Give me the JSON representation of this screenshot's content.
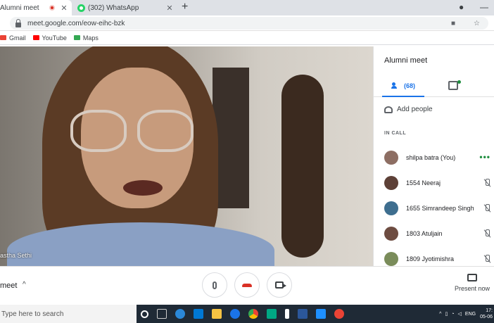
{
  "browser": {
    "tabs": [
      {
        "title": "Alumni meet",
        "recording": true
      },
      {
        "title": "(302) WhatsApp"
      }
    ],
    "url": "meet.google.com/eow-eihc-bzk",
    "bookmarks": [
      {
        "label": "Gmail",
        "icon": "gmail-icon",
        "color": "#ea4335"
      },
      {
        "label": "YouTube",
        "icon": "youtube-icon",
        "color": "#ff0000"
      },
      {
        "label": "Maps",
        "icon": "maps-icon",
        "color": "#34a853"
      }
    ]
  },
  "meeting": {
    "title": "Alumni meet",
    "participant_count": "(68)",
    "add_people": "Add people",
    "in_call_label": "IN CALL",
    "video_name": "astha Sethi",
    "bottom_label": "meet",
    "present_label": "Present now",
    "participants": [
      {
        "name": "shilpa batra (You)",
        "status": "more",
        "avatar_color": "#8d6e63"
      },
      {
        "name": "1554 Neeraj",
        "status": "muted",
        "avatar_color": "#5d4037"
      },
      {
        "name": "1655 Simrandeep Singh",
        "status": "muted",
        "avatar_color": "#3e6e8f"
      },
      {
        "name": "1803 Atuljain",
        "status": "muted",
        "avatar_color": "#6d4c41"
      },
      {
        "name": "1809 Jyotimishra",
        "status": "muted",
        "avatar_color": "#7a8c5a"
      }
    ]
  },
  "taskbar": {
    "search_placeholder": "Type here to search",
    "lang": "ENG",
    "time": "17:",
    "date": "05-06"
  },
  "colors": {
    "accent": "#1a73e8",
    "hangup": "#d93025",
    "taskbar": "#1f2a36"
  }
}
